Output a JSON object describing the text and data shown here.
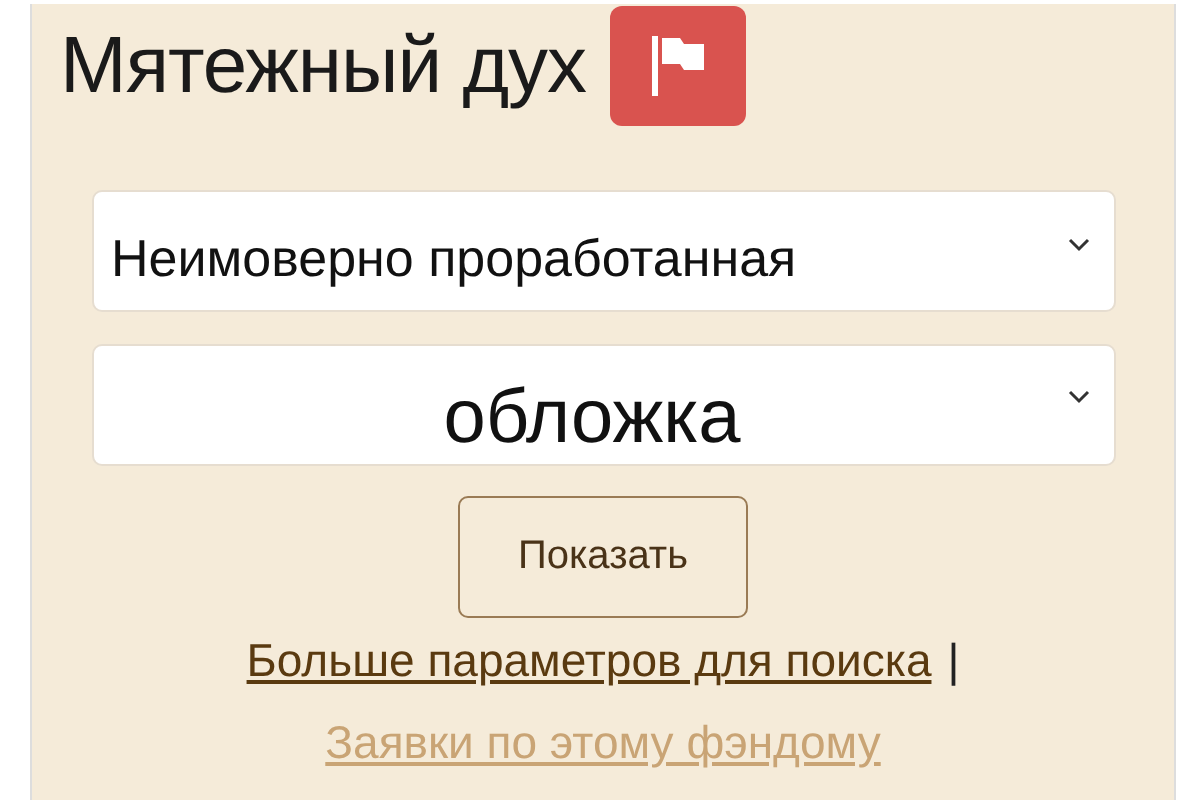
{
  "title": "Мятежный дух",
  "selects": [
    {
      "value": "Неимоверно проработанная"
    },
    {
      "value": "обложка"
    }
  ],
  "button": "Показать",
  "links": [
    {
      "label": "Больше параметров для поиска",
      "visited": false,
      "separator": "|"
    },
    {
      "label": "Заявки по этому фэндому",
      "visited": true
    }
  ]
}
